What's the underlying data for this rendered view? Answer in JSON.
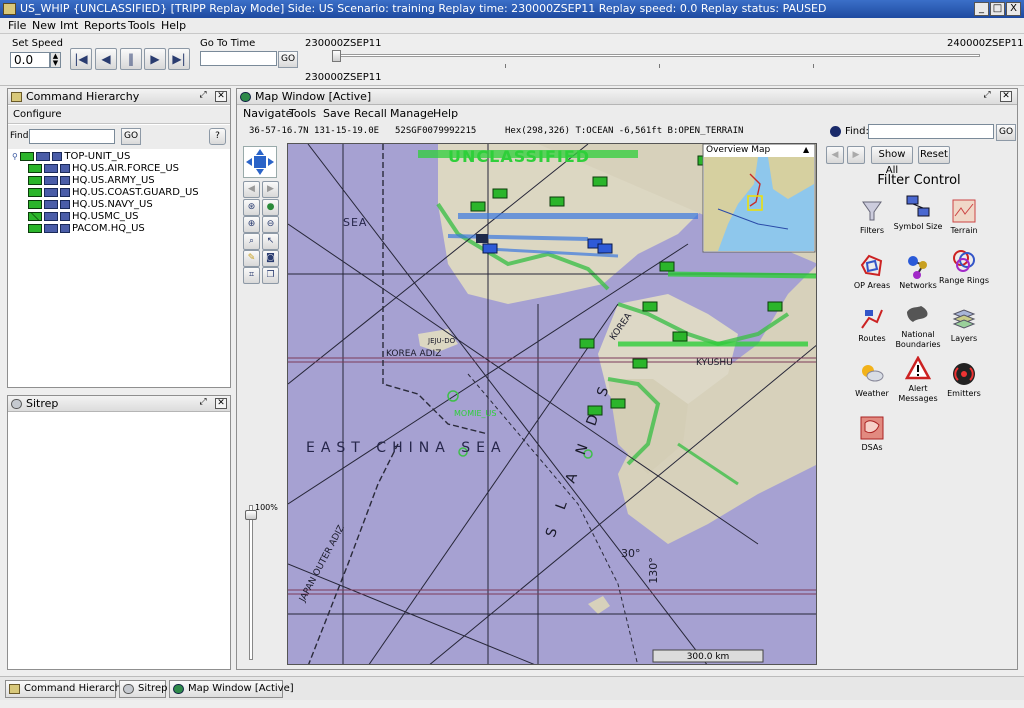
{
  "window": {
    "title": "US_WHIP {UNCLASSIFIED} [TRIPP Replay Mode]  Side: US  Scenario: training  Replay time: 230000ZSEP11  Replay speed: 0.0  Replay status: PAUSED",
    "controls": [
      "_",
      "□",
      "X"
    ]
  },
  "menu": [
    "File",
    "New",
    "Imt",
    "Reports",
    "Tools",
    "Help"
  ],
  "toolbar": {
    "set_speed_label": "Set Speed",
    "speed_value": "0.0",
    "go_to_time_label": "Go To Time",
    "go_label": "GO",
    "timeline_start": "230000ZSEP11",
    "timeline_end": "240000ZSEP11",
    "timeline_current": "230000ZSEP11",
    "timeline_position": 0.01
  },
  "command_hierarchy": {
    "title": "Command Hierarchy",
    "configure": "Configure",
    "find_label": "Find:",
    "go_label": "GO",
    "help_label": "?",
    "items": [
      {
        "label": "TOP-UNIT_US",
        "level": 0
      },
      {
        "label": "HQ.US.AIR.FORCE_US",
        "level": 1
      },
      {
        "label": "HQ.US.ARMY_US",
        "level": 1
      },
      {
        "label": "HQ.US.COAST.GUARD_US",
        "level": 1
      },
      {
        "label": "HQ.US.NAVY_US",
        "level": 1
      },
      {
        "label": "HQ.USMC_US",
        "level": 1
      },
      {
        "label": "PACOM.HQ_US",
        "level": 1
      }
    ]
  },
  "sitrep": {
    "title": "Sitrep"
  },
  "map_window": {
    "title": "Map Window [Active]",
    "menu": [
      "Navigate",
      "Tools",
      "Save",
      "Recall",
      "Manage",
      "Help"
    ],
    "coords": "36-57-16.7N 131-15-19.0E",
    "mgrs": "52SGF0079992215",
    "hex": "Hex(298,326) T:OCEAN -6,561ft B:OPEN_TERRAIN",
    "find_label": "Find:",
    "go_label": "GO",
    "zoom_label": "100%",
    "classification": "UNCLASSIFIED",
    "overview_title": "Overview Map",
    "scale_label": "300.0 km",
    "map_labels": {
      "sea1": "SEA",
      "east_china_sea": "EAST CHINA SEA",
      "korea_adiz": "KOREA ADIZ",
      "japan_outer_adiz": "JAPAN OUTER ADIZ",
      "jeju": "JEJU-DO",
      "kyushu": "KYUSHU",
      "momie": "MOMIE_US",
      "lat30": "30°",
      "lon130": "130°",
      "islands": "S L A N D S",
      "korea": "KOREA"
    }
  },
  "filter_control": {
    "title": "Filter Control",
    "show_all": "Show All",
    "reset": "Reset",
    "items": [
      {
        "label": "Filters",
        "icon": "filter-funnel-icon"
      },
      {
        "label": "Symbol Size",
        "icon": "symbol-size-icon"
      },
      {
        "label": "Terrain",
        "icon": "terrain-icon"
      },
      {
        "label": "OP Areas",
        "icon": "op-areas-icon"
      },
      {
        "label": "Networks",
        "icon": "networks-icon"
      },
      {
        "label": "Range Rings",
        "icon": "range-rings-icon"
      },
      {
        "label": "Routes",
        "icon": "routes-icon"
      },
      {
        "label": "National Boundaries",
        "icon": "national-boundaries-icon"
      },
      {
        "label": "Layers",
        "icon": "layers-icon"
      },
      {
        "label": "Weather",
        "icon": "weather-icon"
      },
      {
        "label": "Alert Messages",
        "icon": "alert-icon"
      },
      {
        "label": "Emitters",
        "icon": "emitters-icon"
      },
      {
        "label": "DSAs",
        "icon": "dsa-icon"
      }
    ]
  },
  "taskbar": [
    "Command Hierarchy",
    "Sitrep",
    "Map Window [Active]"
  ]
}
